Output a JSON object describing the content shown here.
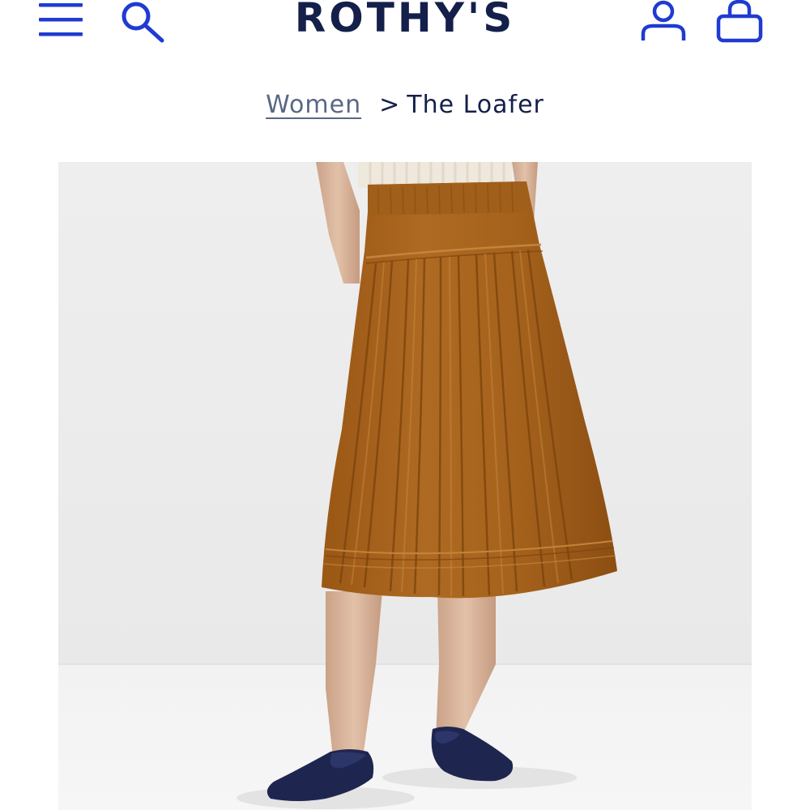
{
  "header": {
    "brand": "ROTHY'S",
    "icons": {
      "menu": "hamburger-menu-icon",
      "search": "search-icon",
      "account": "account-icon",
      "bag": "shopping-bag-icon"
    },
    "icon_color": "#1f3bd1",
    "brand_color": "#14204a"
  },
  "breadcrumb": {
    "parent": "Women",
    "separator": ">",
    "current": "The Loafer"
  },
  "product": {
    "image_subject": "model wearing rust skirt and navy loafers",
    "skirt_color": "#a5621c",
    "shoe_color": "#1e2650",
    "background_color": "#eeeeee"
  }
}
